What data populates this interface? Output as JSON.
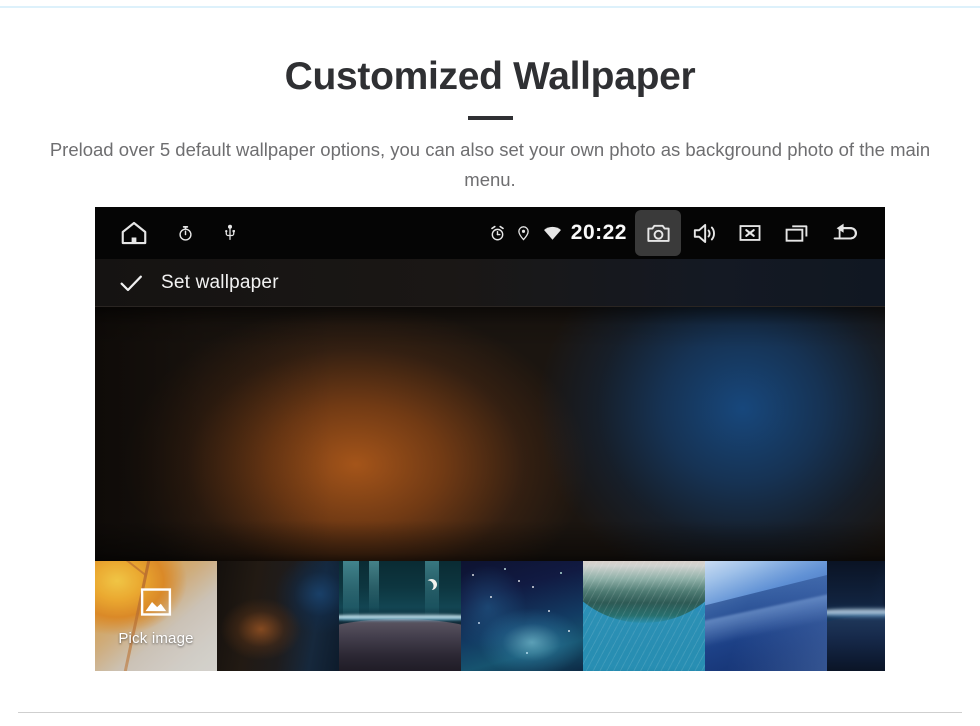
{
  "header": {
    "title": "Customized Wallpaper",
    "subtitle": "Preload over 5 default wallpaper options, you can also set your own photo as background photo of the main menu."
  },
  "device": {
    "statusbar": {
      "left_icons": [
        {
          "name": "home-icon",
          "label": "Home"
        },
        {
          "name": "stopwatch-icon",
          "label": "Stopwatch"
        },
        {
          "name": "usb-icon",
          "label": "USB"
        }
      ],
      "right_icons": [
        {
          "name": "alarm-icon",
          "label": "Alarm"
        },
        {
          "name": "location-pin-icon",
          "label": "Location"
        },
        {
          "name": "wifi-icon",
          "label": "Wi-Fi"
        }
      ],
      "clock": "20:22",
      "nav_buttons": [
        {
          "name": "camera-icon",
          "label": "Screenshot",
          "pressed": true
        },
        {
          "name": "volume-icon",
          "label": "Volume",
          "pressed": false
        },
        {
          "name": "close-box-icon",
          "label": "Close",
          "pressed": false
        },
        {
          "name": "recents-icon",
          "label": "Recents",
          "pressed": false
        },
        {
          "name": "back-arrow-icon",
          "label": "Back",
          "pressed": false
        }
      ]
    },
    "actionbar": {
      "confirm_icon": "check-icon",
      "label": "Set wallpaper"
    },
    "preview": {
      "description": "Blurred wallpaper preview: warm orange glow on the left, deep blue glow on the right"
    },
    "thumbnails": [
      {
        "name": "thumb-pick-image",
        "label": "Pick image",
        "icon": "picture-icon",
        "selected": true
      },
      {
        "name": "thumb-blurred-lights",
        "label": "",
        "icon": "",
        "selected": false
      },
      {
        "name": "thumb-earth-horizon",
        "label": "",
        "icon": "",
        "selected": false
      },
      {
        "name": "thumb-nebula",
        "label": "",
        "icon": "",
        "selected": false
      },
      {
        "name": "thumb-wave",
        "label": "",
        "icon": "",
        "selected": false
      },
      {
        "name": "thumb-blue-geometric",
        "label": "",
        "icon": "",
        "selected": false
      },
      {
        "name": "thumb-planet-eclipse",
        "label": "",
        "icon": "",
        "selected": false
      }
    ]
  },
  "colors": {
    "title": "#2f3033",
    "subtitle": "#6e6e70",
    "statusbar_bg": "#050505",
    "pressed_bg": "#3a3a3a",
    "icon": "#e6e6e6",
    "top_rule": "#ddf1fb",
    "bottom_rule": "#cfcfcf"
  }
}
